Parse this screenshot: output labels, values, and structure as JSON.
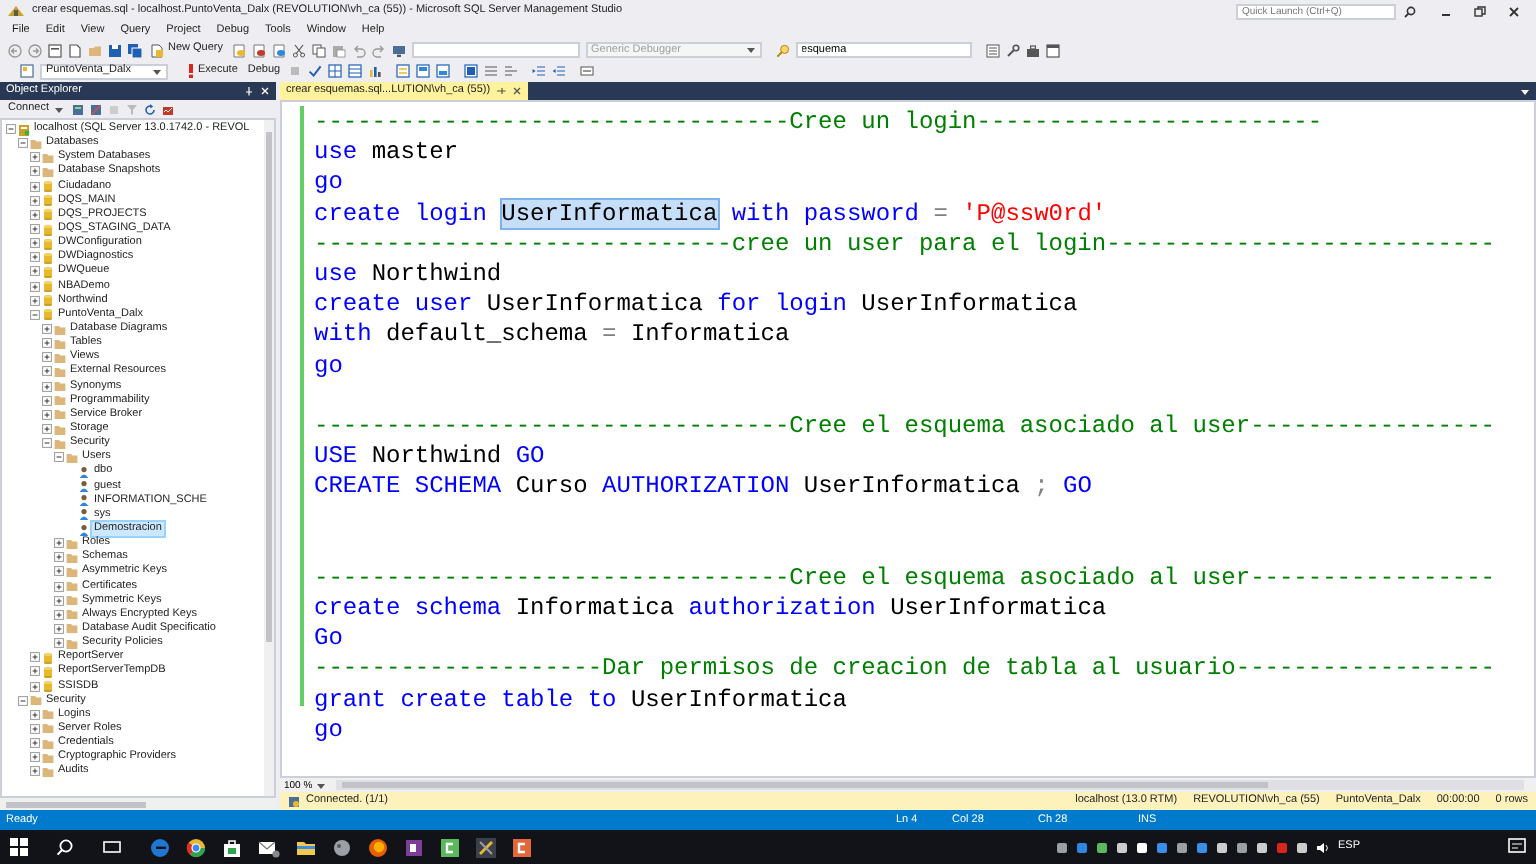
{
  "window": {
    "title": "crear esquemas.sql - localhost.PuntoVenta_Dalx (REVOLUTION\\vh_ca (55)) - Microsoft SQL Server Management Studio"
  },
  "quick_launch": {
    "placeholder": "Quick Launch (Ctrl+Q)"
  },
  "menu": [
    "File",
    "Edit",
    "View",
    "Query",
    "Project",
    "Debug",
    "Tools",
    "Window",
    "Help"
  ],
  "toolbar": {
    "new_query": "New Query",
    "debugger": {
      "label": "Generic Debugger",
      "disabled": true
    },
    "find": {
      "value": "esquema"
    }
  },
  "query_toolbar": {
    "database": "PuntoVenta_Dalx",
    "execute": "Execute",
    "debug": "Debug"
  },
  "object_explorer": {
    "title": "Object Explorer",
    "connect": "Connect",
    "tree": [
      {
        "label": "localhost (SQL Server 13.0.1742.0 - REVOL",
        "kind": "server",
        "expanded": true,
        "selected": false,
        "children": [
          {
            "label": "Databases",
            "kind": "folder",
            "expanded": true,
            "selected": false,
            "children": [
              {
                "label": "System Databases",
                "kind": "folder",
                "expanded": false,
                "selected": false
              },
              {
                "label": "Database Snapshots",
                "kind": "folder",
                "expanded": false,
                "selected": false
              },
              {
                "label": "Ciudadano",
                "kind": "database",
                "expanded": false,
                "selected": false
              },
              {
                "label": "DQS_MAIN",
                "kind": "database",
                "expanded": false,
                "selected": false
              },
              {
                "label": "DQS_PROJECTS",
                "kind": "database",
                "expanded": false,
                "selected": false
              },
              {
                "label": "DQS_STAGING_DATA",
                "kind": "database",
                "expanded": false,
                "selected": false
              },
              {
                "label": "DWConfiguration",
                "kind": "database",
                "expanded": false,
                "selected": false
              },
              {
                "label": "DWDiagnostics",
                "kind": "database",
                "expanded": false,
                "selected": false
              },
              {
                "label": "DWQueue",
                "kind": "database",
                "expanded": false,
                "selected": false
              },
              {
                "label": "NBADemo",
                "kind": "database",
                "expanded": false,
                "selected": false
              },
              {
                "label": "Northwind",
                "kind": "database",
                "expanded": false,
                "selected": false
              },
              {
                "label": "PuntoVenta_Dalx",
                "kind": "database",
                "expanded": true,
                "selected": false,
                "children": [
                  {
                    "label": "Database Diagrams",
                    "kind": "folder",
                    "expanded": false,
                    "selected": false
                  },
                  {
                    "label": "Tables",
                    "kind": "folder",
                    "expanded": false,
                    "selected": false
                  },
                  {
                    "label": "Views",
                    "kind": "folder",
                    "expanded": false,
                    "selected": false
                  },
                  {
                    "label": "External Resources",
                    "kind": "folder",
                    "expanded": false,
                    "selected": false
                  },
                  {
                    "label": "Synonyms",
                    "kind": "folder",
                    "expanded": false,
                    "selected": false
                  },
                  {
                    "label": "Programmability",
                    "kind": "folder",
                    "expanded": false,
                    "selected": false
                  },
                  {
                    "label": "Service Broker",
                    "kind": "folder",
                    "expanded": false,
                    "selected": false
                  },
                  {
                    "label": "Storage",
                    "kind": "folder",
                    "expanded": false,
                    "selected": false
                  },
                  {
                    "label": "Security",
                    "kind": "folder",
                    "expanded": true,
                    "selected": false,
                    "children": [
                      {
                        "label": "Users",
                        "kind": "folder",
                        "expanded": true,
                        "selected": false,
                        "children": [
                          {
                            "label": "dbo",
                            "kind": "user",
                            "selected": false
                          },
                          {
                            "label": "guest",
                            "kind": "user",
                            "selected": false
                          },
                          {
                            "label": "INFORMATION_SCHE",
                            "kind": "user",
                            "selected": false
                          },
                          {
                            "label": "sys",
                            "kind": "user",
                            "selected": false
                          },
                          {
                            "label": "Demostracion",
                            "kind": "user",
                            "selected": true
                          }
                        ]
                      },
                      {
                        "label": "Roles",
                        "kind": "folder",
                        "expanded": false,
                        "selected": false
                      },
                      {
                        "label": "Schemas",
                        "kind": "folder",
                        "expanded": false,
                        "selected": false
                      },
                      {
                        "label": "Asymmetric Keys",
                        "kind": "folder",
                        "expanded": false,
                        "selected": false
                      },
                      {
                        "label": "Certificates",
                        "kind": "folder",
                        "expanded": false,
                        "selected": false
                      },
                      {
                        "label": "Symmetric Keys",
                        "kind": "folder",
                        "expanded": false,
                        "selected": false
                      },
                      {
                        "label": "Always Encrypted Keys",
                        "kind": "folder",
                        "expanded": false,
                        "selected": false
                      },
                      {
                        "label": "Database Audit Specificatio",
                        "kind": "folder",
                        "expanded": false,
                        "selected": false
                      },
                      {
                        "label": "Security Policies",
                        "kind": "folder",
                        "expanded": false,
                        "selected": false
                      }
                    ]
                  }
                ]
              },
              {
                "label": "ReportServer",
                "kind": "database",
                "expanded": false,
                "selected": false
              },
              {
                "label": "ReportServerTempDB",
                "kind": "database",
                "expanded": false,
                "selected": false
              },
              {
                "label": "SSISDB",
                "kind": "database",
                "expanded": false,
                "selected": false
              }
            ]
          },
          {
            "label": "Security",
            "kind": "folder",
            "expanded": true,
            "selected": false,
            "children": [
              {
                "label": "Logins",
                "kind": "folder",
                "expanded": false,
                "selected": false
              },
              {
                "label": "Server Roles",
                "kind": "folder",
                "expanded": false,
                "selected": false
              },
              {
                "label": "Credentials",
                "kind": "folder",
                "expanded": false,
                "selected": false
              },
              {
                "label": "Cryptographic Providers",
                "kind": "folder",
                "expanded": false,
                "selected": false
              },
              {
                "label": "Audits",
                "kind": "folder",
                "expanded": false,
                "selected": false
              }
            ]
          }
        ]
      }
    ]
  },
  "tabs": [
    {
      "label": "crear esquemas.sql...LUTION\\vh_ca (55))",
      "selected": true
    }
  ],
  "editor": {
    "zoom": "100 %",
    "lines": [
      {
        "kind": "code",
        "tokens": [
          {
            "kind": "comment",
            "text": "---------------------------------Cree un login------------------------"
          }
        ]
      },
      {
        "kind": "code",
        "tokens": [
          {
            "kind": "keyword",
            "text": "use"
          },
          {
            "kind": "plain",
            "text": "master"
          }
        ]
      },
      {
        "kind": "code",
        "tokens": [
          {
            "kind": "keyword",
            "text": "go"
          }
        ]
      },
      {
        "kind": "code",
        "tokens": [
          {
            "kind": "keyword",
            "text": "create login"
          },
          {
            "kind": "highlighted",
            "text": "UserInformatica"
          },
          {
            "kind": "keyword",
            "text": "with password"
          },
          {
            "kind": "operator",
            "text": "="
          },
          {
            "kind": "string",
            "text": "'P@ssw0rd'"
          }
        ]
      },
      {
        "kind": "code",
        "tokens": [
          {
            "kind": "comment",
            "text": "-----------------------------cree un user para el login---------------------------"
          }
        ]
      },
      {
        "kind": "code",
        "tokens": [
          {
            "kind": "keyword",
            "text": "use"
          },
          {
            "kind": "plain",
            "text": "Northwind"
          }
        ]
      },
      {
        "kind": "code",
        "tokens": [
          {
            "kind": "keyword",
            "text": "create user"
          },
          {
            "kind": "plain",
            "text": "UserInformatica"
          },
          {
            "kind": "keyword",
            "text": "for login"
          },
          {
            "kind": "plain",
            "text": "UserInformatica"
          }
        ]
      },
      {
        "kind": "code",
        "tokens": [
          {
            "kind": "keyword",
            "text": "with"
          },
          {
            "kind": "plain",
            "text": "default_schema"
          },
          {
            "kind": "operator",
            "text": "="
          },
          {
            "kind": "plain",
            "text": "Informatica"
          }
        ]
      },
      {
        "kind": "code",
        "tokens": [
          {
            "kind": "keyword",
            "text": "go"
          }
        ]
      },
      {
        "kind": "blank"
      },
      {
        "kind": "code",
        "tokens": [
          {
            "kind": "comment",
            "text": "---------------------------------Cree el esquema asociado al user-----------------"
          }
        ]
      },
      {
        "kind": "code",
        "tokens": [
          {
            "kind": "keyword",
            "text": "USE"
          },
          {
            "kind": "plain",
            "text": "Northwind"
          },
          {
            "kind": "keyword",
            "text": "GO"
          }
        ]
      },
      {
        "kind": "code",
        "tokens": [
          {
            "kind": "keyword",
            "text": "CREATE SCHEMA"
          },
          {
            "kind": "plain",
            "text": "Curso"
          },
          {
            "kind": "keyword",
            "text": "AUTHORIZATION"
          },
          {
            "kind": "plain",
            "text": "UserInformatica"
          },
          {
            "kind": "operator",
            "text": ";"
          },
          {
            "kind": "keyword",
            "text": "GO"
          }
        ]
      },
      {
        "kind": "blank"
      },
      {
        "kind": "blank"
      },
      {
        "kind": "code",
        "tokens": [
          {
            "kind": "comment",
            "text": "---------------------------------Cree el esquema asociado al user-----------------"
          }
        ]
      },
      {
        "kind": "code",
        "tokens": [
          {
            "kind": "keyword",
            "text": "create schema"
          },
          {
            "kind": "plain",
            "text": "Informatica"
          },
          {
            "kind": "keyword",
            "text": "authorization"
          },
          {
            "kind": "plain",
            "text": "UserInformatica"
          }
        ]
      },
      {
        "kind": "code",
        "tokens": [
          {
            "kind": "keyword",
            "text": "Go"
          }
        ]
      },
      {
        "kind": "code",
        "tokens": [
          {
            "kind": "comment",
            "text": "--------------------Dar permisos de creacion de tabla al usuario------------------"
          }
        ]
      },
      {
        "kind": "code",
        "tokens": [
          {
            "kind": "keyword",
            "text": "grant create table to"
          },
          {
            "kind": "plain",
            "text": "UserInformatica"
          }
        ]
      },
      {
        "kind": "code",
        "tokens": [
          {
            "kind": "keyword",
            "text": "go"
          }
        ]
      }
    ]
  },
  "connection_bar": {
    "status": "Connected. (1/1)",
    "server": "localhost (13.0 RTM)",
    "user": "REVOLUTION\\vh_ca (55)",
    "database": "PuntoVenta_Dalx",
    "elapsed": "00:00:00",
    "rows": "0 rows"
  },
  "status_bar": {
    "state": "Ready",
    "line": "Ln 4",
    "column": "Col 28",
    "char": "Ch 28",
    "mode": "INS"
  },
  "taskbar": {
    "language": "ESP"
  }
}
